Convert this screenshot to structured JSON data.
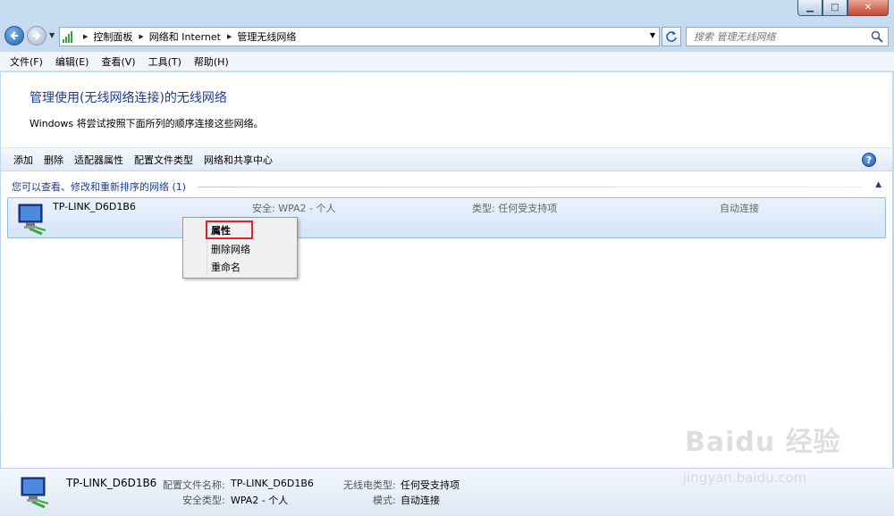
{
  "window": {
    "minimize_glyph": "▁",
    "maximize_glyph": "□",
    "close_glyph": "✕"
  },
  "nav": {
    "breadcrumbs": [
      "控制面板",
      "网络和 Internet",
      "管理无线网络"
    ],
    "search_placeholder": "搜索 管理无线网络"
  },
  "menubar": {
    "items": [
      "文件(F)",
      "编辑(E)",
      "查看(V)",
      "工具(T)",
      "帮助(H)"
    ]
  },
  "main": {
    "title": "管理使用(无线网络连接)的无线网络",
    "description": "Windows 将尝试按照下面所列的顺序连接这些网络。"
  },
  "toolbar": {
    "items": [
      "添加",
      "删除",
      "适配器属性",
      "配置文件类型",
      "网络和共享中心"
    ],
    "help_glyph": "?"
  },
  "group": {
    "header": "您可以查看、修改和重新排序的网络 (1)"
  },
  "networks": [
    {
      "name": "TP-LINK_D6D1B6",
      "security": "安全: WPA2 - 个人",
      "type": "类型: 任何受支持项",
      "mode": "自动连接"
    }
  ],
  "context_menu": {
    "items": [
      "属性",
      "删除网络",
      "重命名"
    ],
    "highlighted_index": 0
  },
  "details": {
    "name": "TP-LINK_D6D1B6",
    "profile_label": "配置文件名称:",
    "profile_value": "TP-LINK_D6D1B6",
    "security_label": "安全类型:",
    "security_value": "WPA2 - 个人",
    "radio_label": "无线电类型:",
    "radio_value": "任何受支持项",
    "mode_label": "模式:",
    "mode_value": "自动连接"
  },
  "watermark": {
    "logo": "Baidu 经验",
    "url": "jingyan.baidu.com"
  },
  "colors": {
    "title_blue": "#1e3d8f",
    "highlight_red": "#e4202b"
  }
}
